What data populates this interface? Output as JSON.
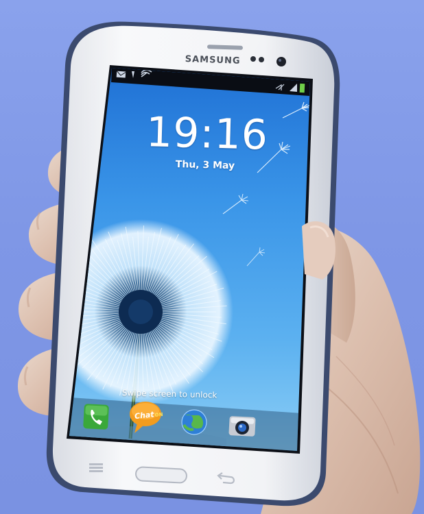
{
  "phone": {
    "brand": "SAMSUNG"
  },
  "lockscreen": {
    "time": "19:16",
    "date": "Thu, 3 May",
    "unlock_hint": "Swipe screen to unlock"
  },
  "dock": {
    "chaton_main": "Chat",
    "chaton_sub": "ON"
  },
  "colors": {
    "background": "#8aa2ec",
    "phone_body": "#f3f4f6",
    "phone_rim": "#3b4a6e",
    "screen_sky": "#2f8be0",
    "phone_accent": "#56a82a"
  },
  "icons": {
    "status_left": [
      "mail-icon",
      "usb-icon",
      "wifi-icon"
    ],
    "status_right": [
      "signal-icon",
      "battery-icon"
    ],
    "dock": [
      "phone-icon",
      "chaton-icon",
      "internet-globe-icon",
      "camera-icon"
    ],
    "hardware": [
      "menu-key-icon",
      "home-button",
      "back-key-icon"
    ]
  }
}
